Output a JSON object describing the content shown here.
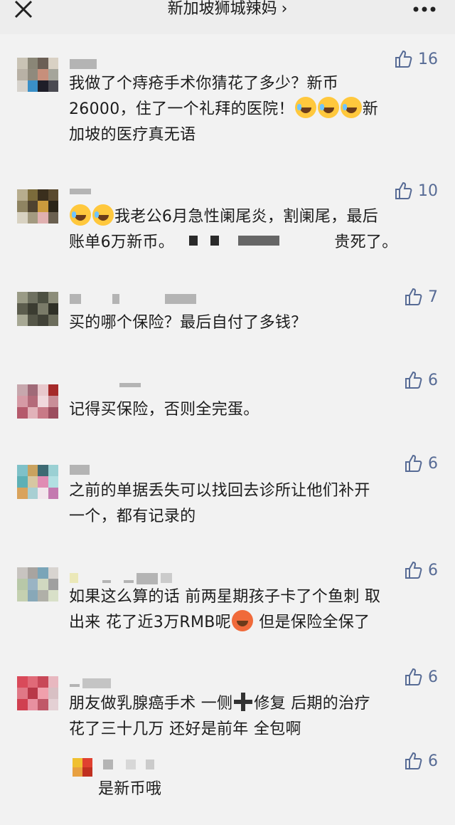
{
  "header": {
    "title": "新加坡狮城辣妈",
    "chevron": "chevron-right-icon",
    "close_icon": "close-icon",
    "more_icon": "more-icon"
  },
  "colors": {
    "accent": "#576b95",
    "background": "#ededed"
  },
  "comments": [
    {
      "likes": "16",
      "text": [
        "我做了个痔疮手术你猜花了多少？新币",
        "26000，住了一个礼拜的医院！",
        "新",
        "加坡的医疗真无语"
      ]
    },
    {
      "likes": "10",
      "text": [
        "我老公6月急性阑尾炎，割阑尾，最后",
        "账单6万新币。",
        "贵死了。"
      ]
    },
    {
      "likes": "7",
      "text": [
        "买的哪个保险？最后自付了多钱？"
      ]
    },
    {
      "likes": "6",
      "text": [
        "记得买保险，否则全完蛋。"
      ]
    },
    {
      "likes": "6",
      "text": [
        "之前的单据丢失可以找回去诊所让他们补开",
        "一个，都有记录的"
      ]
    },
    {
      "likes": "6",
      "text": [
        "如果这么算的话 前两星期孩子卡了个鱼刺 取",
        "出来 花了近3万RMB呢",
        "但是保险全保了"
      ]
    },
    {
      "likes": "6",
      "text": [
        "朋友做乳腺癌手术 一侧",
        "修复 后期的治疗",
        "花了三十几万 还好是前年 全包啊"
      ]
    },
    {
      "likes": "6",
      "text": [
        "是新币哦"
      ]
    }
  ]
}
